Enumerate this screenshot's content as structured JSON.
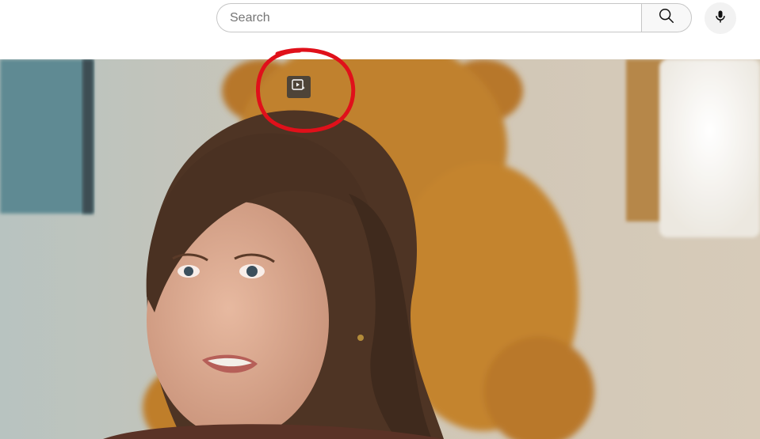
{
  "header": {
    "search": {
      "placeholder": "Search",
      "value": ""
    },
    "icons": {
      "search": "search-icon",
      "mic": "microphone-icon"
    }
  },
  "player": {
    "overlay_icon": "video-sparkle-icon",
    "annotation_color": "#e0101a"
  },
  "colors": {
    "header_bg": "#ffffff",
    "search_border": "#c6c6c6",
    "search_button_bg": "#f8f8f8",
    "mic_button_bg": "#f2f2f2"
  }
}
